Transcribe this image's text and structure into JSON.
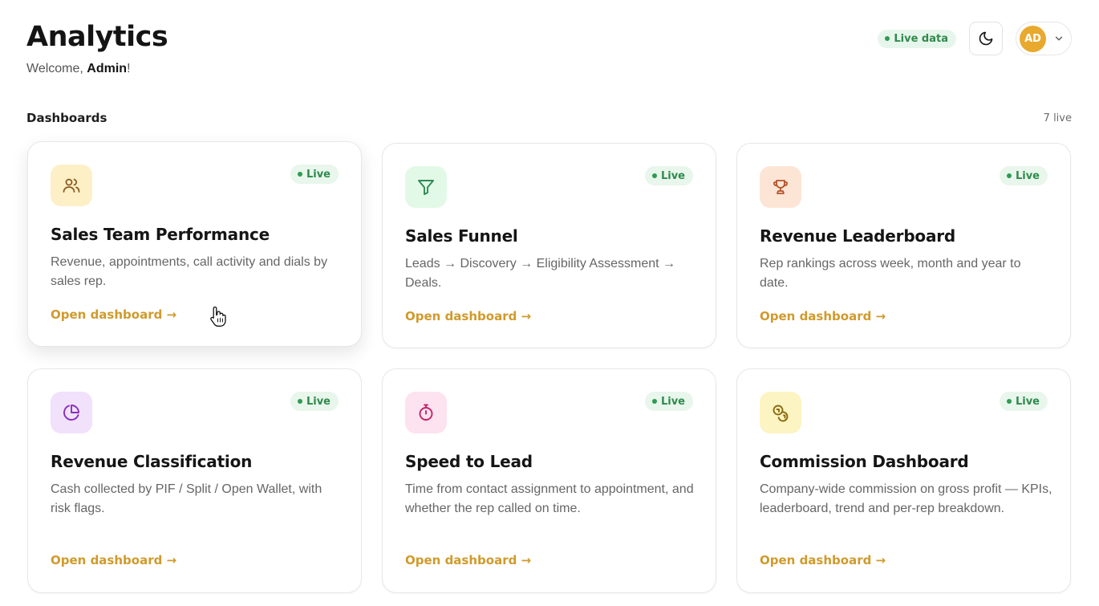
{
  "header": {
    "title": "Analytics",
    "welcome_prefix": "Welcome, ",
    "welcome_user": "Admin",
    "welcome_suffix": "!",
    "live_data_label": "Live data",
    "avatar_initials": "AD"
  },
  "section": {
    "title": "Dashboards",
    "count": "7 live"
  },
  "colors": {
    "accent_link": "#d09a2c",
    "live_green": "#2f8a4c",
    "avatar": "#e8a92d"
  },
  "cards": [
    {
      "icon": "users-icon",
      "live": "Live",
      "title": "Sales Team Performance",
      "desc": "Revenue, appointments, call activity and dials by sales rep.",
      "link": "Open dashboard →"
    },
    {
      "icon": "funnel-icon",
      "live": "Live",
      "title": "Sales Funnel",
      "desc": "Leads → Discovery → Eligibility Assessment → Deals.",
      "link": "Open dashboard →"
    },
    {
      "icon": "trophy-icon",
      "live": "Live",
      "title": "Revenue Leaderboard",
      "desc": "Rep rankings across week, month and year to date.",
      "link": "Open dashboard →"
    },
    {
      "icon": "pie-chart-icon",
      "live": "Live",
      "title": "Revenue Classification",
      "desc": "Cash collected by PIF / Split / Open Wallet, with risk flags.",
      "link": "Open dashboard →"
    },
    {
      "icon": "stopwatch-icon",
      "live": "Live",
      "title": "Speed to Lead",
      "desc": "Time from contact assignment to appointment, and whether the rep called on time.",
      "link": "Open dashboard →"
    },
    {
      "icon": "coins-icon",
      "live": "Live",
      "title": "Commission Dashboard",
      "desc": "Company-wide commission on gross profit — KPIs, leaderboard, trend and per-rep breakdown.",
      "link": "Open dashboard →"
    }
  ]
}
